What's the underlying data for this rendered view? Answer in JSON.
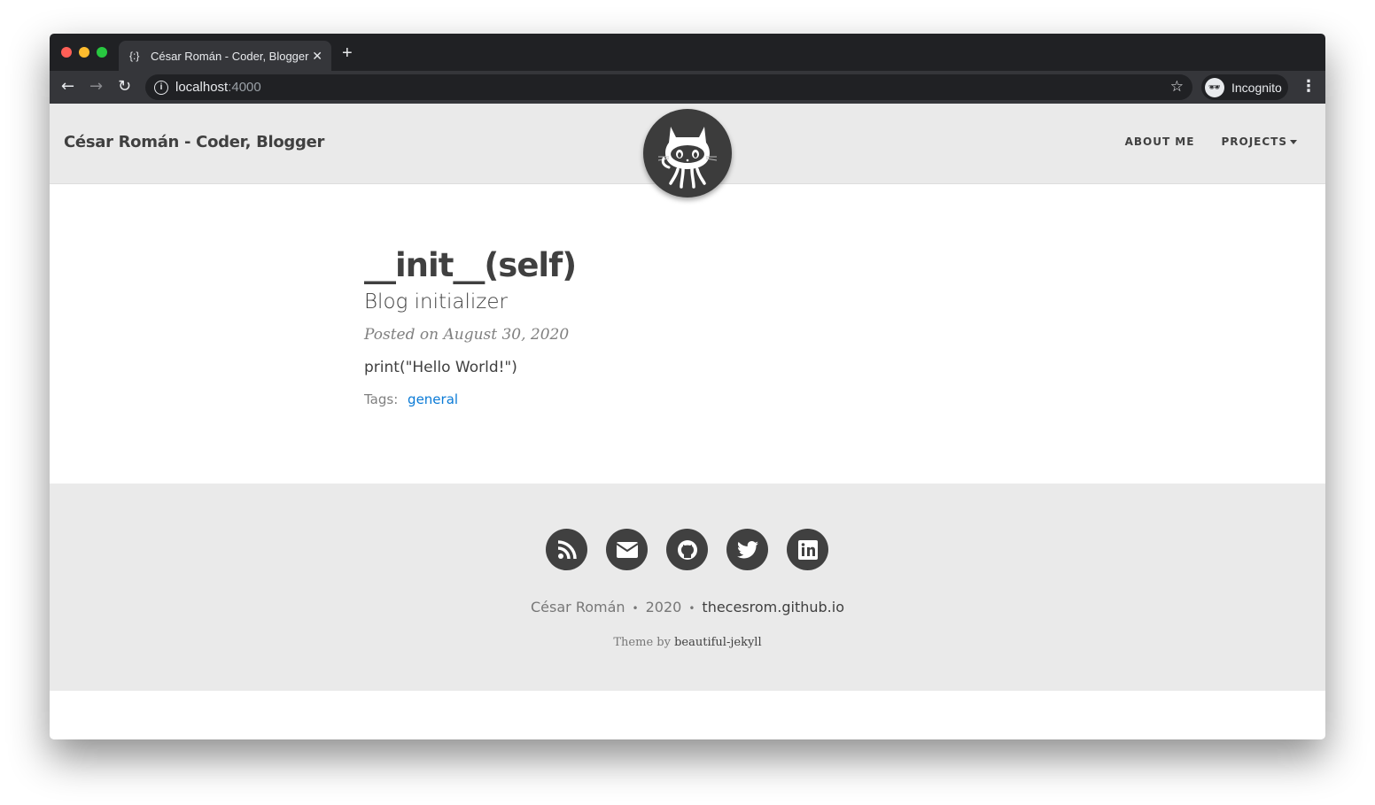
{
  "browser": {
    "tab_title": "César Román - Coder, Blogger",
    "tab_icon": "jekyll-favicon-icon",
    "new_tab_label": "+",
    "url_host": "localhost",
    "url_port": ":4000",
    "incognito_label": "Incognito"
  },
  "navbar": {
    "brand": "César Román - Coder, Blogger",
    "links": [
      {
        "label": "ABOUT ME"
      },
      {
        "label": "PROJECTS",
        "has_dropdown": true
      }
    ],
    "avatar_icon": "github-octocat-icon"
  },
  "post": {
    "title": "__init__(self)",
    "subtitle": "Blog initializer",
    "meta": "Posted on August 30, 2020",
    "body": "print(\"Hello World!\")",
    "tags_label": "Tags:",
    "tags": [
      "general"
    ]
  },
  "footer": {
    "social_icons": [
      "rss-icon",
      "email-icon",
      "github-icon",
      "twitter-icon",
      "linkedin-icon"
    ],
    "author": "César Román",
    "separator": "•",
    "year": "2020",
    "site": "thecesrom.github.io",
    "theme_prefix": "Theme by",
    "theme_name": "beautiful-jekyll"
  },
  "colors": {
    "tag_link": "#0a7ad6",
    "nav_bg": "#eaeaea",
    "text": "#404040"
  }
}
